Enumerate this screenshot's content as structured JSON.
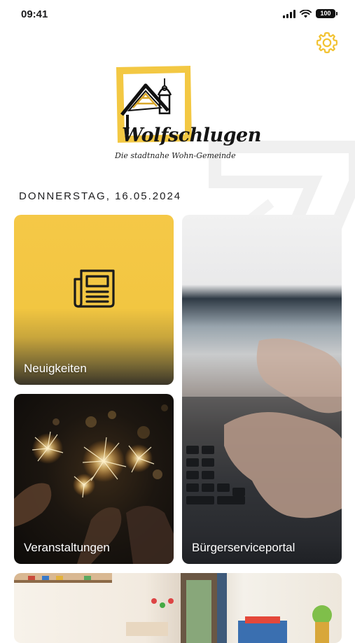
{
  "status_bar": {
    "time": "09:41",
    "battery": "100"
  },
  "logo": {
    "name": "Wolfschlugen",
    "tagline": "Die stadtnahe Wohn-Gemeinde"
  },
  "date": "DONNERSTAG, 16.05.2024",
  "tiles": [
    {
      "label": "Neuigkeiten"
    },
    {
      "label": "Veranstaltungen"
    },
    {
      "label": "Bürgerserviceportal"
    }
  ],
  "colors": {
    "accent": "#f5c847",
    "settings_icon": "#f2c230",
    "text": "#1c1c1e"
  },
  "icons": {
    "settings": "gear-icon",
    "news": "newspaper-icon"
  }
}
